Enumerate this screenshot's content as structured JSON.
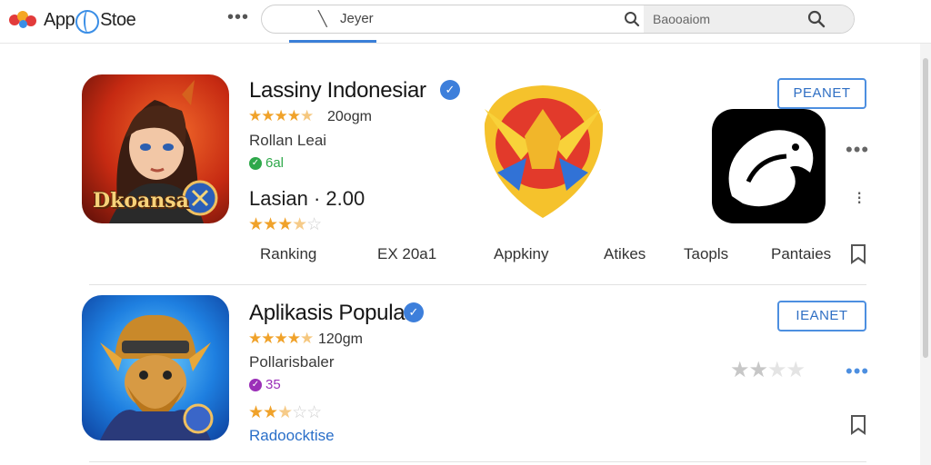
{
  "header": {
    "logo_text_a": "App",
    "logo_text_b": "Stoe",
    "more": "•••",
    "search_arrow": "╲",
    "search_value": "Jeyer",
    "search_placeholder": "Baooaiom"
  },
  "apps": [
    {
      "title": "Lassiny Indonesiar",
      "rating_text": "20oɡm",
      "rating": 4.5,
      "developer": "Rollan Leai",
      "badge": "6al",
      "icon_caption": "Dkoansa",
      "price_line": "Lasian · 2.00",
      "rating2": 3.5,
      "button": "PEANET",
      "tabs": [
        "Ranking",
        "EX 20a1",
        "Appkiny",
        "Atikes",
        "Taopls",
        "Pantaies"
      ]
    },
    {
      "title": "Aplikasis Popular",
      "rating_text": "120ɡm",
      "rating": 4.5,
      "developer": "Pollarisbaler",
      "badge": "35",
      "rating2": 2.5,
      "link": "Radoocktise",
      "button": "IEANET"
    }
  ],
  "colors": {
    "accent": "#3d7fdb",
    "star": "#f0a22a",
    "badge_green": "#2ea84a",
    "badge_purple": "#9b2fb8"
  },
  "icons": [
    "search-icon",
    "verified-icon",
    "bookmark-icon",
    "more-icon",
    "help-icon"
  ]
}
